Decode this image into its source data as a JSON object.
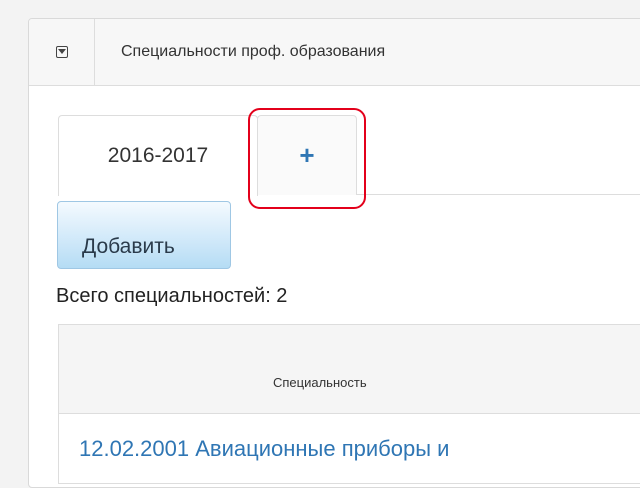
{
  "panel": {
    "title": "Специальности проф. образования",
    "collapse_icon": "collapse-toggle-icon"
  },
  "tabs": [
    {
      "label": "2016-2017",
      "active": true
    },
    {
      "label": "+",
      "active": false
    }
  ],
  "toolbar": {
    "add_label": "Добавить"
  },
  "summary": {
    "count_text": "Всего специальностей: 2"
  },
  "table": {
    "columns": [
      "Специальность"
    ],
    "rows": [
      {
        "specialty": "12.02.2001 Авиационные приборы и"
      }
    ]
  },
  "colors": {
    "link": "#2f76b4",
    "highlight": "#e3001b",
    "button_gradient_bottom": "#b5dcf4"
  }
}
